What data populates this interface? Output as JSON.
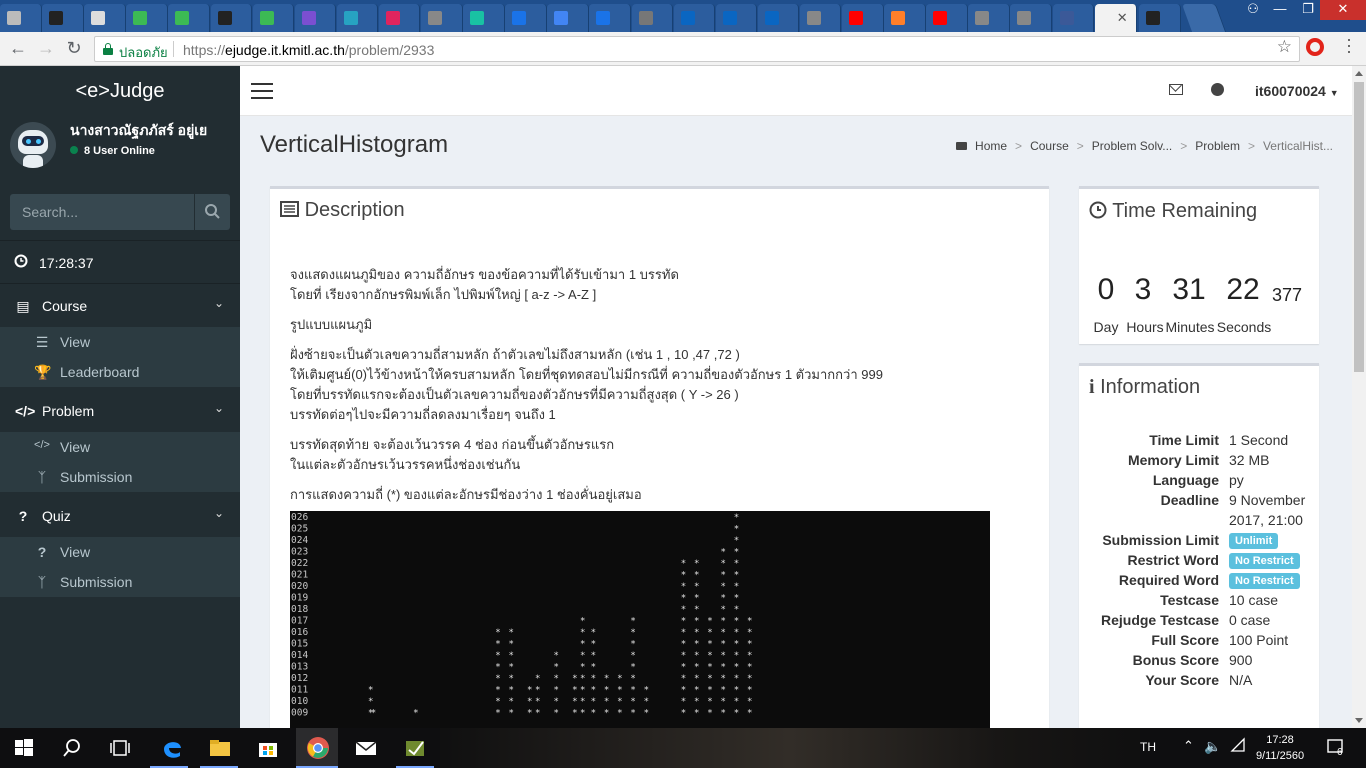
{
  "browser": {
    "secure_label": "ปลอดภัย",
    "url_scheme": "https://",
    "url_host": "ejudge.it.kmitl.ac.th",
    "url_path": "/problem/2933"
  },
  "sidebar": {
    "brand": "<e>Judge",
    "user_name": "นางสาวณัฐภภัสร์ อยู่เย",
    "online_text": "8 User Online",
    "search_placeholder": "Search...",
    "clock": "17:28:37",
    "menus": [
      {
        "label": "Course",
        "items": [
          "View",
          "Leaderboard"
        ]
      },
      {
        "label": "Problem",
        "items": [
          "View",
          "Submission"
        ]
      },
      {
        "label": "Quiz",
        "items": [
          "View",
          "Submission"
        ]
      }
    ]
  },
  "header": {
    "user_id": "it60070024"
  },
  "page": {
    "title": "VerticalHistogram",
    "breadcrumb": [
      "Home",
      "Course",
      "Problem Solv...",
      "Problem",
      "VerticalHist..."
    ]
  },
  "description": {
    "title": "Description",
    "lines": [
      [
        "จงแสดงแผนภูมิของ ความถี่อักษร ของข้อความที่ได้รับเข้ามา 1 บรรทัด",
        "โดยที่ เรียงจากอักษรพิมพ์เล็ก ไปพิมพ์ใหญ่ [ a-z -> A-Z ]"
      ],
      [
        "รูปแบบแผนภูมิ"
      ],
      [
        "ฝั่งซ้ายจะเป็นตัวเลขความถี่สามหลัก ถ้าตัวเลขไม่ถึงสามหลัก (เช่น 1 , 10 ,47 ,72 )",
        "ให้เติมศูนย์(0)ไว้ข้างหน้าให้ครบสามหลัก โดยที่ชุดทดสอบไม่มีกรณีที่ ความถี่ของตัวอักษร 1 ตัวมากกว่า 999",
        "โดยที่บรรทัดแรกจะต้องเป็นตัวเลขความถี่ของตัวอักษรที่มีความถี่สูงสุด ( Y -> 26 )",
        "บรรทัดต่อๆไปจะมีความถี่ลดลงมาเรื่อยๆ จนถึง 1"
      ],
      [
        "บรรทัดสุดท้าย จะต้องเว้นวรรค 4 ช่อง ก่อนขึ้นตัวอักษรแรก",
        "ในแต่ละตัวอักษรเว้นวรรคหนึ่งช่องเช่นกัน"
      ],
      [
        "การแสดงความถี่ (*) ของแต่ละอักษรมีช่องว่าง 1 ช่องคั่นอยู่เสมอ"
      ]
    ],
    "terminal_rows": [
      "026",
      "025",
      "024",
      "023",
      "022",
      "021",
      "020",
      "019",
      "018",
      "017",
      "016",
      "015",
      "014",
      "013",
      "012",
      "011",
      "010",
      "009"
    ],
    "histogram_heights": [
      0,
      0,
      0,
      0,
      0,
      0,
      0,
      0,
      0,
      0,
      0,
      0,
      0,
      0,
      0,
      0,
      0,
      11,
      9,
      0,
      0,
      0,
      0,
      0,
      0,
      0,
      0,
      0,
      0,
      0,
      0,
      0,
      0,
      0,
      9,
      0,
      0,
      0,
      0,
      0,
      0,
      0,
      0,
      0,
      0,
      0,
      0,
      0,
      0,
      0,
      0,
      0,
      0,
      0,
      0,
      0,
      0,
      0,
      0,
      0,
      0,
      0,
      0,
      0,
      0,
      16,
      0,
      0,
      0,
      0,
      16,
      0,
      0,
      0,
      0,
      0,
      0,
      11,
      0,
      0,
      12,
      0,
      0,
      0,
      0,
      0,
      0,
      14,
      0,
      0,
      0,
      0,
      0,
      0,
      12,
      0,
      0,
      17,
      0,
      0,
      0,
      16,
      0,
      0,
      0,
      0,
      12,
      0,
      0,
      0,
      0,
      12,
      0,
      0,
      0,
      0,
      17,
      0,
      0,
      0,
      0,
      11,
      0,
      0,
      0,
      0,
      0,
      0,
      0,
      0,
      0,
      0,
      0,
      0,
      0,
      22,
      0,
      0,
      0,
      0,
      22,
      0,
      0,
      0,
      0,
      17,
      0,
      0,
      0,
      0,
      23,
      0,
      0,
      0,
      0,
      26,
      0,
      0,
      0,
      0,
      17,
      0
    ]
  },
  "time_remaining": {
    "title": "Time Remaining",
    "values": [
      "0",
      "3",
      "31",
      "22",
      "377"
    ],
    "labels": [
      "Day",
      "Hours",
      "Minutes",
      "Seconds"
    ]
  },
  "information": {
    "title": "Information",
    "rows": [
      {
        "k": "Time Limit",
        "v": "1 Second"
      },
      {
        "k": "Memory Limit",
        "v": "32 MB"
      },
      {
        "k": "Language",
        "v": "py"
      },
      {
        "k": "Deadline",
        "v": "9 November"
      },
      {
        "k": "",
        "v": "2017, 21:00"
      },
      {
        "k": "Submission Limit",
        "v": "Unlimit",
        "badge": true
      },
      {
        "k": "Restrict Word",
        "v": "No Restrict",
        "badge": true
      },
      {
        "k": "Required Word",
        "v": "No Restrict",
        "badge": true
      },
      {
        "k": "Testcase",
        "v": "10 case"
      },
      {
        "k": "Rejudge Testcase",
        "v": "0 case"
      },
      {
        "k": "Full Score",
        "v": "100 Point"
      },
      {
        "k": "Bonus Score",
        "v": "900"
      },
      {
        "k": "Your Score",
        "v": "N/A"
      }
    ]
  },
  "taskbar": {
    "lang": "TH",
    "time": "17:28",
    "date": "9/11/2560",
    "notif_count": "6"
  },
  "colors": {
    "sidebar_bg": "#222d32",
    "submenu_bg": "#2c3b41",
    "badge_info": "#5bc0de",
    "tab_bar": "#1f4e8c"
  }
}
